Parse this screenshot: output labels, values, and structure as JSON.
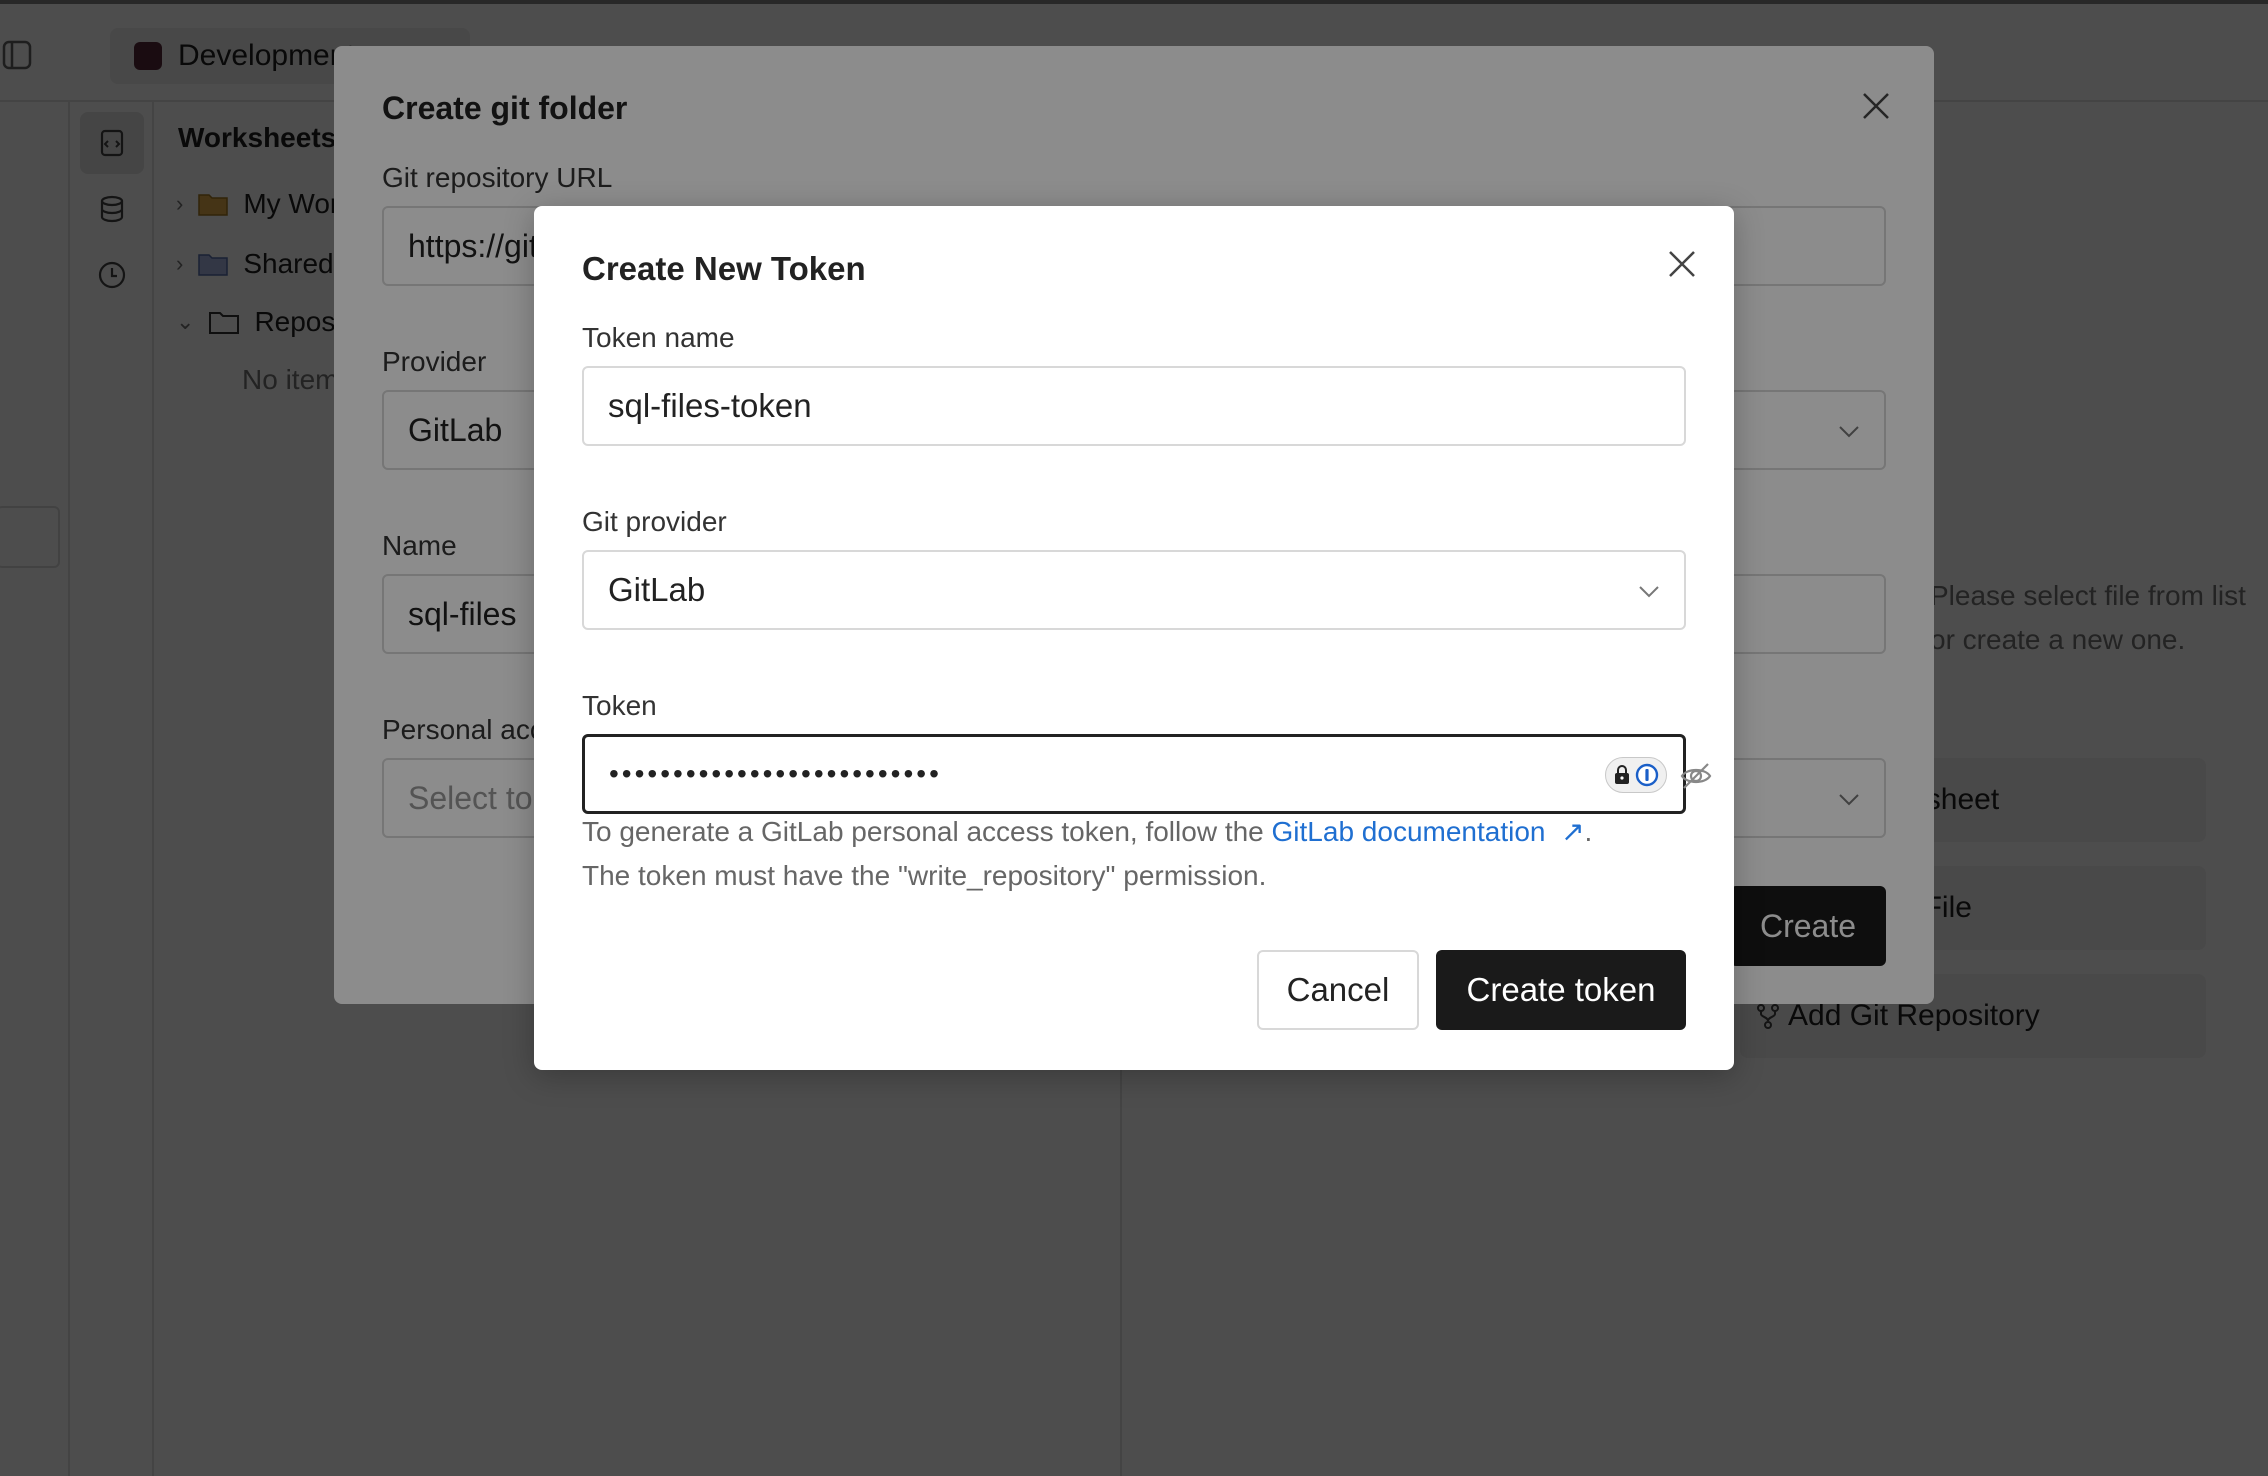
{
  "background": {
    "tab_title": "Development",
    "sidebar_title": "Worksheets",
    "tree_items": [
      "My Worksheets",
      "Shared",
      "Repositories"
    ],
    "tree_empty": "No items",
    "empty_state": "Please select file from list or create a new one.",
    "actions": [
      "New Worksheet",
      "New SQL File",
      "Add Git Repository"
    ]
  },
  "git_folder_modal": {
    "title": "Create git folder",
    "url_label": "Git repository URL",
    "url_value": "https://gitlab.com/",
    "provider_label": "Provider",
    "provider_value": "GitLab",
    "name_label": "Name",
    "name_value": "sql-files",
    "pat_label": "Personal access token",
    "pat_placeholder": "Select token",
    "create_label": "Create"
  },
  "token_modal": {
    "title": "Create New Token",
    "token_name_label": "Token name",
    "token_name_value": "sql-files-token",
    "git_provider_label": "Git provider",
    "git_provider_value": "GitLab",
    "token_label": "Token",
    "token_masked": "••••••••••••••••••••••••••",
    "help_prefix": "To generate a GitLab personal access token, follow the ",
    "help_link": "GitLab documentation",
    "help_link_icon": "↗",
    "help_suffix": ".",
    "help_line2": "The token must have the \"write_repository\" permission.",
    "cancel_label": "Cancel",
    "create_label": "Create token"
  },
  "colors": {
    "primary_button": "#1a1a1a",
    "link": "#1f6fd1",
    "overlay": "rgba(0,0,0,0.45)"
  }
}
